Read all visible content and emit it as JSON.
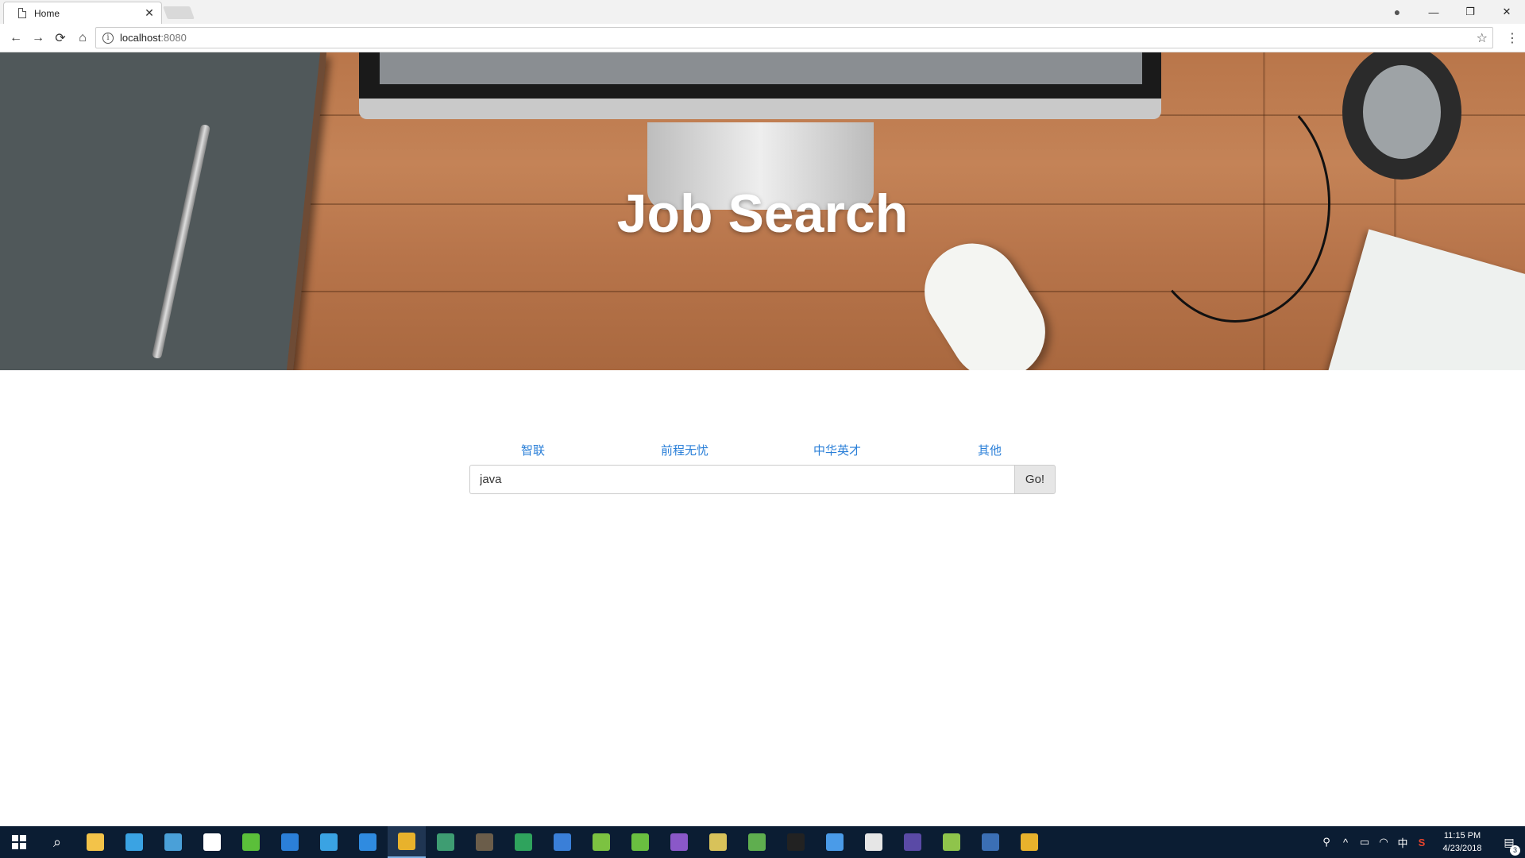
{
  "browser": {
    "tab_title": "Home",
    "tab_close": "✕",
    "url_host": "localhost",
    "url_port": ":8080",
    "nav": {
      "back": "←",
      "forward": "→",
      "reload": "⟳",
      "home": "⌂"
    },
    "window": {
      "minimize": "—",
      "restore": "❐",
      "close": "✕"
    },
    "account_icon": "account-icon",
    "star": "☆",
    "menu": "⋮",
    "info": "i"
  },
  "hero": {
    "title": "Job Search"
  },
  "search": {
    "sources": [
      "智联",
      "前程无忧",
      "中华英才",
      "其他"
    ],
    "query": "java",
    "go_label": "Go!",
    "link_color": "#2a7fd8"
  },
  "taskbar": {
    "apps": [
      {
        "name": "file-explorer",
        "color": "#f3c349"
      },
      {
        "name": "store",
        "color": "#3aa3e3"
      },
      {
        "name": "remote-desktop",
        "color": "#4aa0d8"
      },
      {
        "name": "task-view",
        "color": "#ffffff"
      },
      {
        "name": "360-browser",
        "color": "#5bbf3a"
      },
      {
        "name": "edge",
        "color": "#2b7fd8"
      },
      {
        "name": "internet-explorer",
        "color": "#3aa3e3"
      },
      {
        "name": "vscode",
        "color": "#2f8be0"
      },
      {
        "name": "chrome",
        "color": "#e8b22c"
      },
      {
        "name": "app-green",
        "color": "#3e9d72"
      },
      {
        "name": "sublime",
        "color": "#6b5d4a"
      },
      {
        "name": "app-dollar",
        "color": "#2fa35d"
      },
      {
        "name": "intellij",
        "color": "#3a7fd8"
      },
      {
        "name": "notepad-plus",
        "color": "#7cc241"
      },
      {
        "name": "spring-tool",
        "color": "#6abf40"
      },
      {
        "name": "visual-studio",
        "color": "#8a58c8"
      },
      {
        "name": "tools",
        "color": "#d8c25a"
      },
      {
        "name": "app-sheet",
        "color": "#5fae4f"
      },
      {
        "name": "terminal",
        "color": "#222222"
      },
      {
        "name": "app-window",
        "color": "#4a9be8"
      },
      {
        "name": "mail",
        "color": "#e6e6e6"
      },
      {
        "name": "eclipse",
        "color": "#5a4aa6"
      },
      {
        "name": "android-studio",
        "color": "#8fc44b"
      },
      {
        "name": "mysql-workbench",
        "color": "#3b6fb5"
      },
      {
        "name": "git",
        "color": "#e8b22c"
      }
    ],
    "active_app": "chrome",
    "tray": {
      "people": "⚲",
      "chevron": "^",
      "ime": "中",
      "sogou": "S",
      "time": "11:15 PM",
      "date": "4/23/2018",
      "notif_count": "3"
    }
  }
}
